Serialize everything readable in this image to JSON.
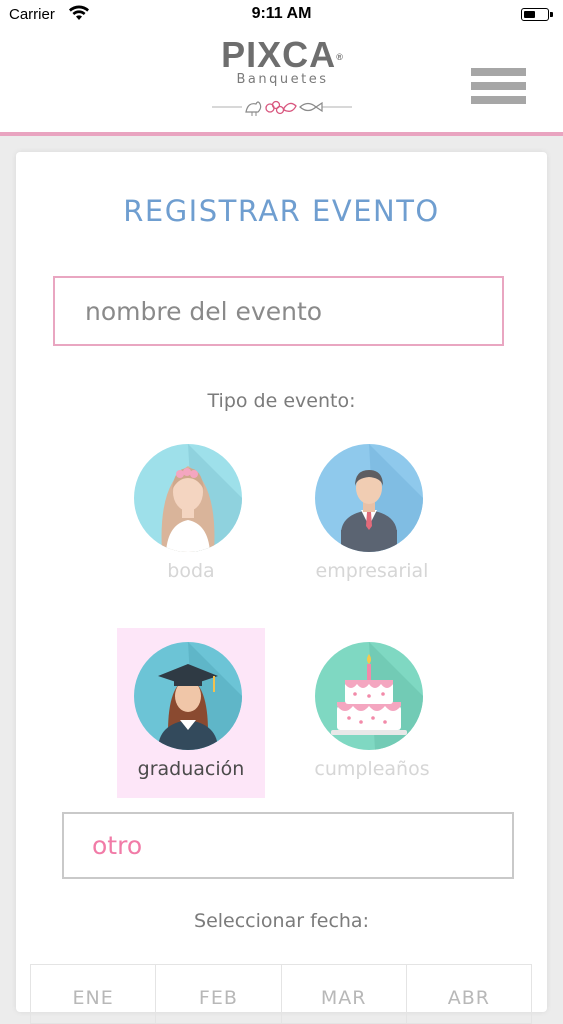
{
  "status_bar": {
    "carrier": "Carrier",
    "time": "9:11 AM"
  },
  "header": {
    "brand": "PIXCA",
    "registered_mark": "®",
    "subtitle": "Banquetes",
    "menu_icon": "hamburger-menu-icon",
    "accent_color": "#e9a4c0"
  },
  "form": {
    "title": "REGISTRAR EVENTO",
    "name_placeholder": "nombre del evento",
    "event_type_label": "Tipo de evento:",
    "event_types": [
      {
        "label": "boda",
        "icon": "bride-icon",
        "selected": false
      },
      {
        "label": "empresarial",
        "icon": "businessman-icon",
        "selected": false
      },
      {
        "label": "graduación",
        "icon": "graduate-icon",
        "selected": true
      },
      {
        "label": "cumpleaños",
        "icon": "birthday-cake-icon",
        "selected": false
      }
    ],
    "other_placeholder": "otro",
    "date_label": "Seleccionar fecha:",
    "months": [
      "ENE",
      "FEB",
      "MAR",
      "ABR"
    ]
  },
  "colors": {
    "title": "#6f9ed0",
    "input_border": "#e9a6c1",
    "selected_tile": "#fde6f8",
    "other_text": "#f06da0"
  }
}
